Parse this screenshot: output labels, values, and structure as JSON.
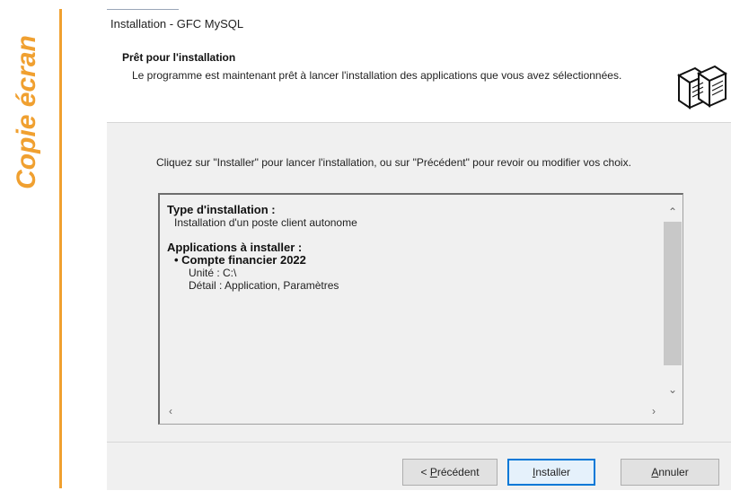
{
  "side_label": "Copie écran",
  "window": {
    "title": "Installation - GFC MySQL"
  },
  "header": {
    "title": "Prêt pour l'installation",
    "subtitle": "Le programme est maintenant prêt à lancer l'installation des applications que vous avez sélectionnées.",
    "icon": "computer-stack-icon"
  },
  "content": {
    "instructions": "Cliquez sur \"Installer\" pour lancer l'installation, ou sur \"Précédent\" pour revoir ou modifier vos choix.",
    "memo": {
      "type_heading": "Type d'installation :",
      "type_value": "Installation d'un poste client autonome",
      "apps_heading": "Applications à installer :",
      "app_name": "Compte financier 2022",
      "app_unit": "Unité : C:\\",
      "app_detail": "Détail : Application, Paramètres"
    }
  },
  "buttons": {
    "back_prefix": "< ",
    "back_hotkey": "P",
    "back_rest": "récédent",
    "install_hotkey": "I",
    "install_rest": "nstaller",
    "cancel_hotkey": "A",
    "cancel_rest": "nnuler"
  },
  "colors": {
    "accent_orange": "#f0a030",
    "focus_blue": "#0078d7"
  }
}
